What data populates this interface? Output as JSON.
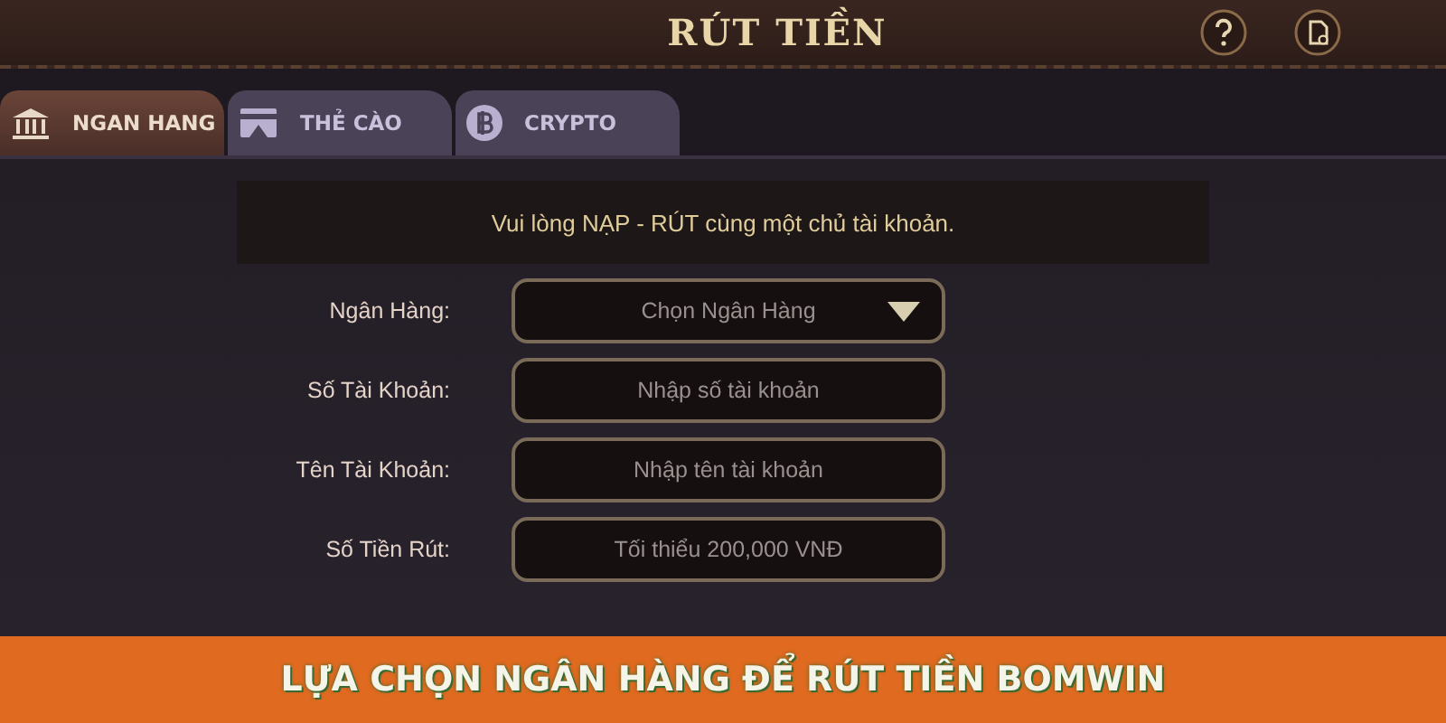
{
  "header": {
    "title": "RÚT TIỀN"
  },
  "tabs": [
    {
      "label": "NGAN HANG",
      "selected": true,
      "kind": "bank"
    },
    {
      "label": "THẺ CÀO",
      "selected": false,
      "kind": "card"
    },
    {
      "label": "CRYPTO",
      "selected": false,
      "kind": "coin"
    }
  ],
  "notice": "Vui lòng NẠP - RÚT cùng một chủ tài khoản.",
  "form": [
    {
      "kind": "select",
      "label": "Ngân Hàng:",
      "placeholder": "Chọn Ngân Hàng"
    },
    {
      "kind": "input",
      "label": "Số Tài Khoản:",
      "placeholder": "Nhập số tài khoản"
    },
    {
      "kind": "input",
      "label": "Tên Tài Khoản:",
      "placeholder": "Nhập tên tài khoản"
    },
    {
      "kind": "input",
      "label": "Số Tiền Rút:",
      "placeholder": "Tối thiểu 200,000 VNĐ"
    }
  ],
  "caption": "LỰA CHỌN NGÂN HÀNG ĐỂ RÚT TIỀN BOMWIN"
}
